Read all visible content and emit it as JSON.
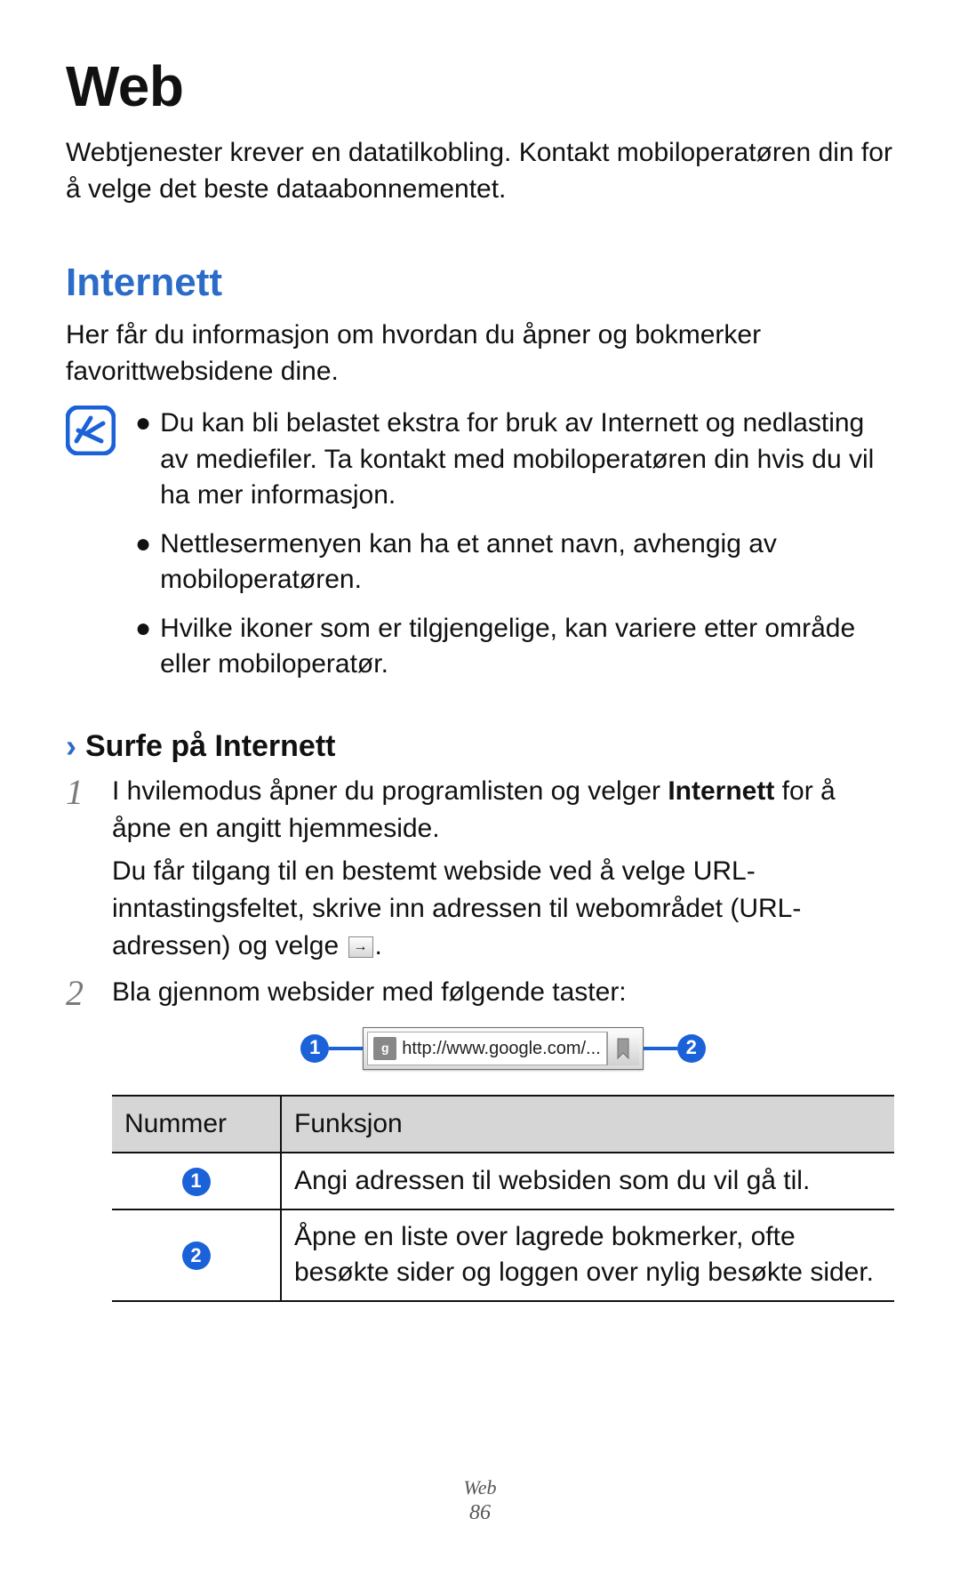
{
  "title": "Web",
  "intro": "Webtjenester krever en datatilkobling. Kontakt mobiloperatøren din for å velge det beste dataabonnementet.",
  "section": {
    "heading": "Internett",
    "desc": "Her får du informasjon om hvordan du åpner og bokmerker favorittwebsidene dine.",
    "notes": [
      "Du kan bli belastet ekstra for bruk av Internett og nedlasting av mediefiler. Ta kontakt med mobiloperatøren din hvis du vil ha mer informasjon.",
      "Nettlesermenyen kan ha et annet navn, avhengig av mobiloperatøren.",
      "Hvilke ikoner som er tilgjengelige, kan variere etter område eller mobiloperatør."
    ]
  },
  "subsection": {
    "chevron": "›",
    "heading": "Surfe på Internett"
  },
  "steps": {
    "s1": {
      "num": "1",
      "line1a": "I hvilemodus åpner du programlisten og velger ",
      "line1b": "Internett",
      "line1c": " for å åpne en angitt hjemmeside.",
      "line2a": "Du får tilgang til en bestemt webside ved å velge URL-inntastingsfeltet, skrive inn adressen til webområdet (URL-adressen) og velge ",
      "line2b": "."
    },
    "s2": {
      "num": "2",
      "line": "Bla gjennom websider med følgende taster:"
    }
  },
  "diagram": {
    "badge1": "1",
    "url": "http://www.google.com/...",
    "badge2": "2"
  },
  "table": {
    "head": {
      "c1": "Nummer",
      "c2": "Funksjon"
    },
    "rows": [
      {
        "badge": "1",
        "func": "Angi adressen til websiden som du vil gå til."
      },
      {
        "badge": "2",
        "func": "Åpne en liste over lagrede bokmerker, ofte besøkte sider og loggen over nylig besøkte sider."
      }
    ]
  },
  "footer": {
    "section": "Web",
    "page": "86"
  },
  "glyphs": {
    "bullet": "●",
    "go": "→",
    "favicon": "g"
  }
}
